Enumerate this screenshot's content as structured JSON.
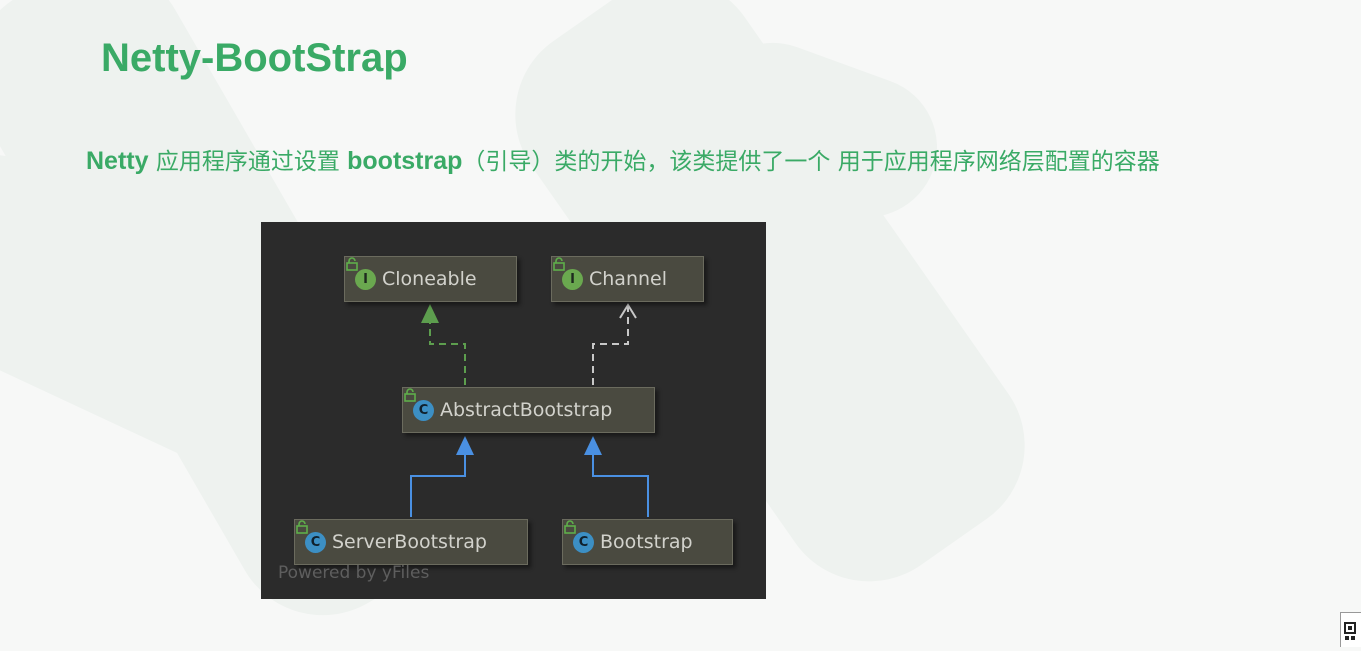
{
  "slide": {
    "title": "Netty-BootStrap",
    "description": {
      "part1": "Netty",
      "part2": " 应用程序通过设置 ",
      "part3": "bootstrap",
      "part4": "（引导）类的开始，该类提供了一个 用于应用程序网络层配置的容器"
    }
  },
  "diagram": {
    "nodes": {
      "cloneable": {
        "kind": "I",
        "label": "Cloneable"
      },
      "channel": {
        "kind": "I",
        "label": "Channel"
      },
      "abstract_bootstrap": {
        "kind": "C",
        "label": "AbstractBootstrap"
      },
      "server_bootstrap": {
        "kind": "C",
        "label": "ServerBootstrap"
      },
      "bootstrap": {
        "kind": "C",
        "label": "Bootstrap"
      }
    },
    "watermark": "Powered by yFiles"
  },
  "colors": {
    "title": "#3aaa66",
    "diagram_bg": "#2b2b2b",
    "interface_badge": "#6aa84f",
    "class_badge": "#3c8fc4",
    "implements_arrow_green": "#5d9e4e",
    "implements_arrow_gray": "#c8c8c8",
    "extends_arrow": "#4a90e2"
  },
  "icons": {
    "interface_badge": "interface-badge-icon",
    "class_badge": "class-badge-icon",
    "visibility": "lock-icon",
    "corner": "qr-code-icon"
  }
}
